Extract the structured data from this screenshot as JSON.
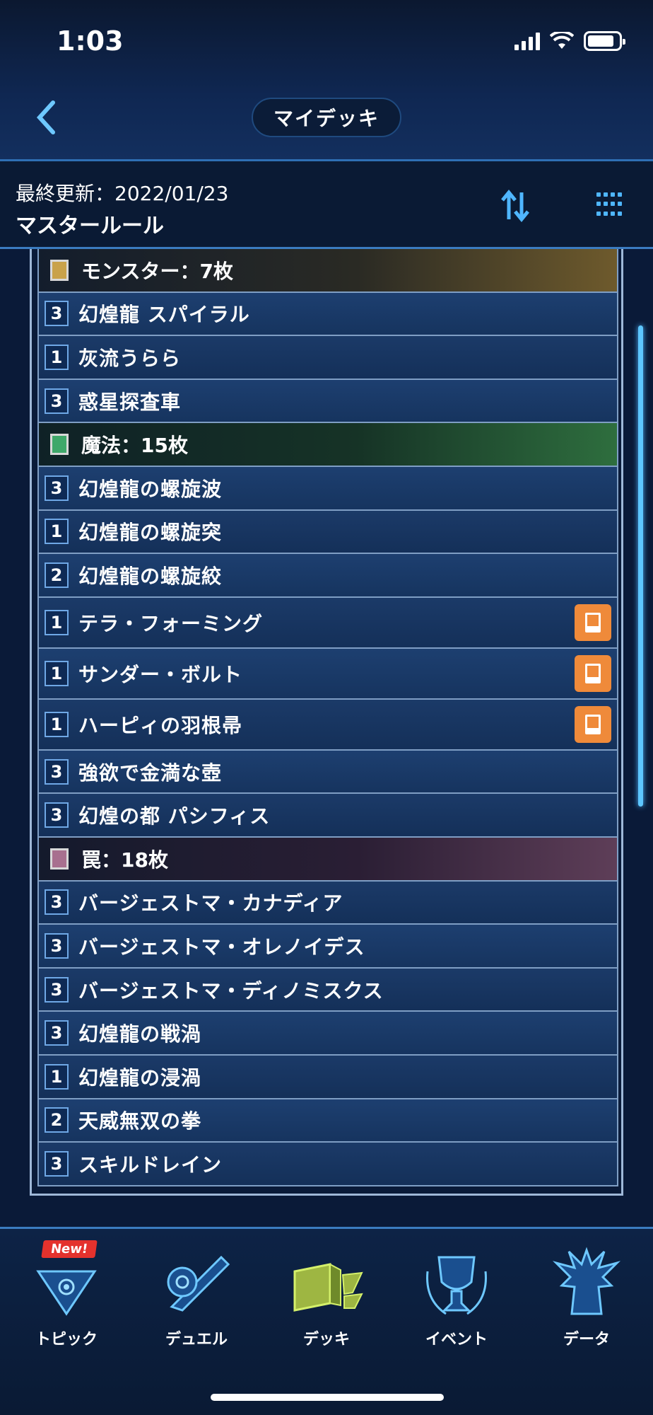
{
  "status": {
    "time": "1:03",
    "battery_level": 0.85
  },
  "header": {
    "title": "マイデッキ"
  },
  "info": {
    "last_updated": "最終更新：2022/01/23",
    "rule": "マスタールール"
  },
  "deck": {
    "monster": {
      "title": "モンスター：7枚",
      "cards": [
        {
          "count": "3",
          "name": "幻煌龍 スパイラル"
        },
        {
          "count": "1",
          "name": "灰流うらら"
        },
        {
          "count": "3",
          "name": "惑星探査車"
        }
      ]
    },
    "spell": {
      "title": "魔法：15枚",
      "cards": [
        {
          "count": "3",
          "name": "幻煌龍の螺旋波"
        },
        {
          "count": "1",
          "name": "幻煌龍の螺旋突"
        },
        {
          "count": "2",
          "name": "幻煌龍の螺旋絞"
        },
        {
          "count": "1",
          "name": "テラ・フォーミング"
        },
        {
          "count": "1",
          "name": "サンダー・ボルト"
        },
        {
          "count": "1",
          "name": "ハーピィの羽根帚"
        },
        {
          "count": "3",
          "name": "強欲で金満な壺"
        },
        {
          "count": "3",
          "name": "幻煌の都 パシフィス"
        }
      ]
    },
    "trap": {
      "title": "罠：18枚",
      "cards": [
        {
          "count": "3",
          "name": "バージェストマ・カナディア"
        },
        {
          "count": "3",
          "name": "バージェストマ・オレノイデス"
        },
        {
          "count": "3",
          "name": "バージェストマ・ディノミスクス"
        },
        {
          "count": "3",
          "name": "幻煌龍の戦渦"
        },
        {
          "count": "1",
          "name": "幻煌龍の浸渦"
        },
        {
          "count": "2",
          "name": "天威無双の拳"
        },
        {
          "count": "3",
          "name": "スキルドレイン"
        }
      ]
    }
  },
  "nav": {
    "topic": "トピック",
    "topic_badge": "New!",
    "duel": "デュエル",
    "deck": "デッキ",
    "event": "イベント",
    "data": "データ"
  },
  "colors": {
    "accent": "#4fb6ff",
    "limit_badge": "#ef8a3a",
    "monster": "#c9a24a",
    "spell": "#3fa86a",
    "trap": "#a8708f"
  }
}
